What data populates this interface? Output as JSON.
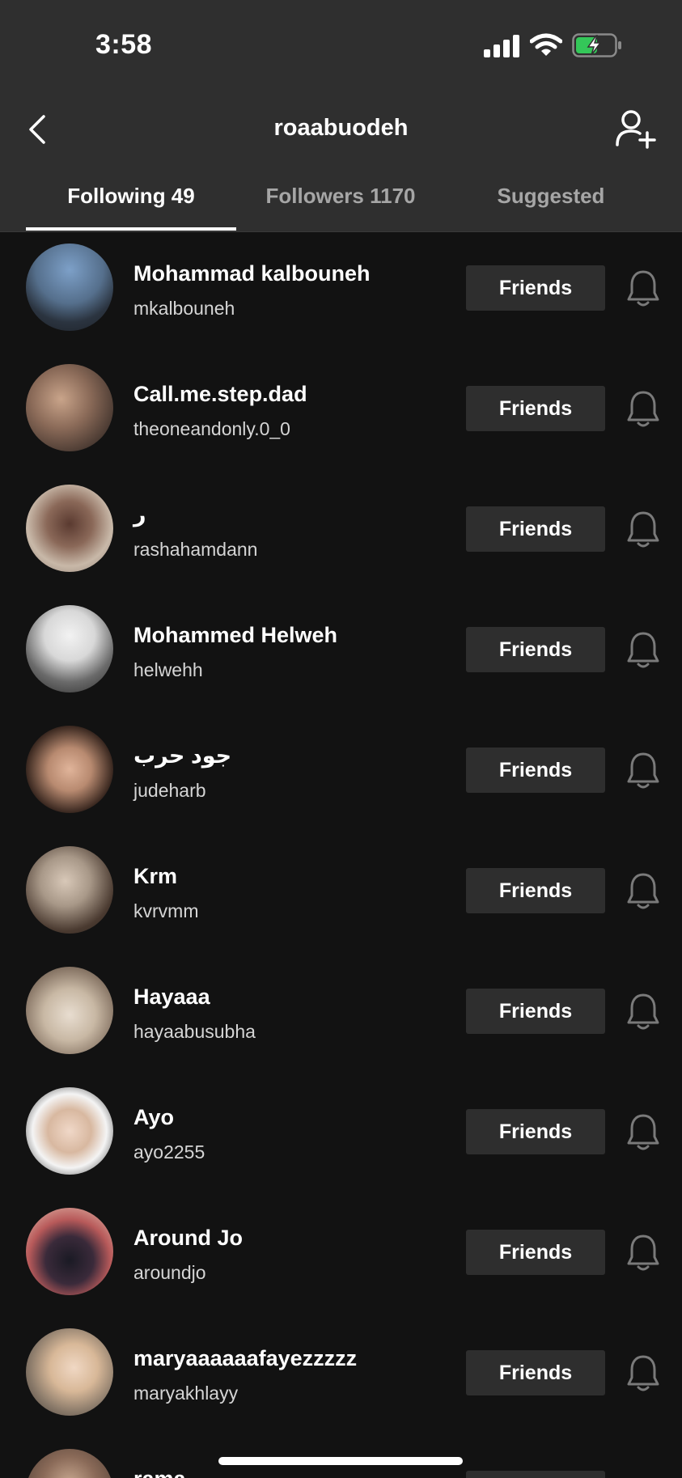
{
  "status": {
    "time": "3:58"
  },
  "header": {
    "title": "roaabuodeh"
  },
  "tabs": [
    {
      "label": "Following 49",
      "active": true
    },
    {
      "label": "Followers 1170",
      "active": false
    },
    {
      "label": "Suggested",
      "active": false
    }
  ],
  "friends_label": "Friends",
  "users": [
    {
      "name": "Mohammad kalbouneh",
      "username": "mkalbouneh"
    },
    {
      "name": "Call.me.step.dad",
      "username": "theoneandonly.0_0"
    },
    {
      "name": "ر",
      "username": "rashahamdann"
    },
    {
      "name": "Mohammed Helweh",
      "username": "helwehh"
    },
    {
      "name": "جود حرب",
      "username": "judeharb"
    },
    {
      "name": "Krm",
      "username": "kvrvmm"
    },
    {
      "name": "Hayaaa",
      "username": "hayaabusubha"
    },
    {
      "name": "Ayo",
      "username": "ayo2255"
    },
    {
      "name": "Around Jo",
      "username": "aroundjo"
    },
    {
      "name": "maryaaaaaafayezzzzz",
      "username": "maryakhlayy"
    },
    {
      "name": "rama",
      "username": ""
    }
  ],
  "colors": {
    "header_bg": "#2f2f2f",
    "list_bg": "#121212",
    "button_bg": "#2e2e2e",
    "battery_fill": "#34c759"
  },
  "icons": [
    "back-arrow-icon",
    "add-user-icon",
    "bell-icon",
    "signal-icon",
    "wifi-icon",
    "battery-icon"
  ]
}
